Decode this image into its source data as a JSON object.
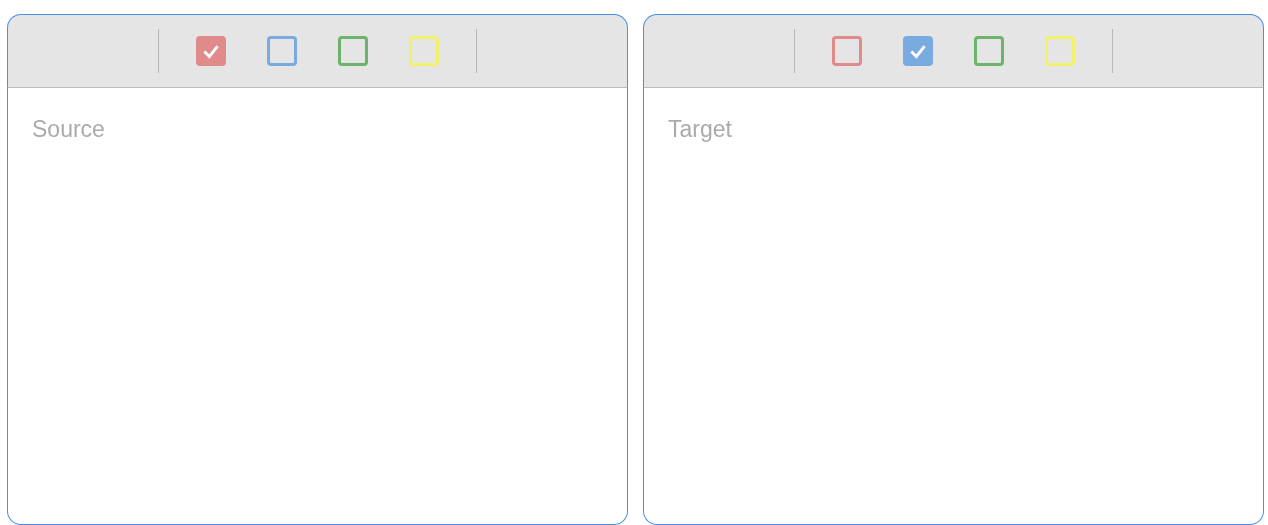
{
  "panels": [
    {
      "checkboxes": [
        {
          "color": "#e08a8a",
          "checked": true
        },
        {
          "color": "#7aabe0",
          "checked": false
        },
        {
          "color": "#6cb46c",
          "checked": false
        },
        {
          "color": "#f2f26a",
          "checked": false
        }
      ],
      "editor": {
        "placeholder": "Source"
      }
    },
    {
      "checkboxes": [
        {
          "color": "#e08a8a",
          "checked": false
        },
        {
          "color": "#7aabe0",
          "checked": true
        },
        {
          "color": "#6cb46c",
          "checked": false
        },
        {
          "color": "#f2f26a",
          "checked": false
        }
      ],
      "editor": {
        "placeholder": "Target"
      }
    }
  ]
}
